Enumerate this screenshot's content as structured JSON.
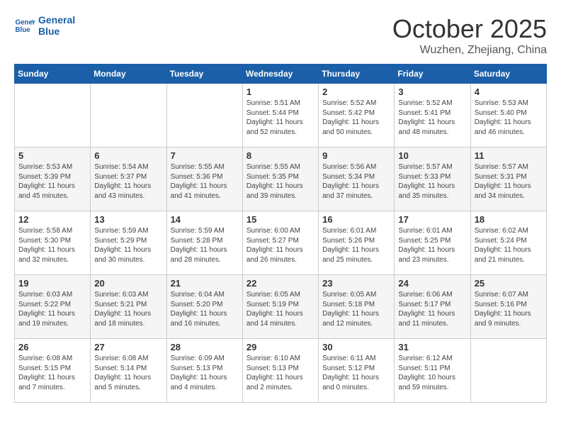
{
  "header": {
    "logo_general": "General",
    "logo_blue": "Blue",
    "title": "October 2025",
    "subtitle": "Wuzhen, Zhejiang, China"
  },
  "weekdays": [
    "Sunday",
    "Monday",
    "Tuesday",
    "Wednesday",
    "Thursday",
    "Friday",
    "Saturday"
  ],
  "weeks": [
    [
      {
        "day": "",
        "info": ""
      },
      {
        "day": "",
        "info": ""
      },
      {
        "day": "",
        "info": ""
      },
      {
        "day": "1",
        "info": "Sunrise: 5:51 AM\nSunset: 5:44 PM\nDaylight: 11 hours\nand 52 minutes."
      },
      {
        "day": "2",
        "info": "Sunrise: 5:52 AM\nSunset: 5:42 PM\nDaylight: 11 hours\nand 50 minutes."
      },
      {
        "day": "3",
        "info": "Sunrise: 5:52 AM\nSunset: 5:41 PM\nDaylight: 11 hours\nand 48 minutes."
      },
      {
        "day": "4",
        "info": "Sunrise: 5:53 AM\nSunset: 5:40 PM\nDaylight: 11 hours\nand 46 minutes."
      }
    ],
    [
      {
        "day": "5",
        "info": "Sunrise: 5:53 AM\nSunset: 5:39 PM\nDaylight: 11 hours\nand 45 minutes."
      },
      {
        "day": "6",
        "info": "Sunrise: 5:54 AM\nSunset: 5:37 PM\nDaylight: 11 hours\nand 43 minutes."
      },
      {
        "day": "7",
        "info": "Sunrise: 5:55 AM\nSunset: 5:36 PM\nDaylight: 11 hours\nand 41 minutes."
      },
      {
        "day": "8",
        "info": "Sunrise: 5:55 AM\nSunset: 5:35 PM\nDaylight: 11 hours\nand 39 minutes."
      },
      {
        "day": "9",
        "info": "Sunrise: 5:56 AM\nSunset: 5:34 PM\nDaylight: 11 hours\nand 37 minutes."
      },
      {
        "day": "10",
        "info": "Sunrise: 5:57 AM\nSunset: 5:33 PM\nDaylight: 11 hours\nand 35 minutes."
      },
      {
        "day": "11",
        "info": "Sunrise: 5:57 AM\nSunset: 5:31 PM\nDaylight: 11 hours\nand 34 minutes."
      }
    ],
    [
      {
        "day": "12",
        "info": "Sunrise: 5:58 AM\nSunset: 5:30 PM\nDaylight: 11 hours\nand 32 minutes."
      },
      {
        "day": "13",
        "info": "Sunrise: 5:59 AM\nSunset: 5:29 PM\nDaylight: 11 hours\nand 30 minutes."
      },
      {
        "day": "14",
        "info": "Sunrise: 5:59 AM\nSunset: 5:28 PM\nDaylight: 11 hours\nand 28 minutes."
      },
      {
        "day": "15",
        "info": "Sunrise: 6:00 AM\nSunset: 5:27 PM\nDaylight: 11 hours\nand 26 minutes."
      },
      {
        "day": "16",
        "info": "Sunrise: 6:01 AM\nSunset: 5:26 PM\nDaylight: 11 hours\nand 25 minutes."
      },
      {
        "day": "17",
        "info": "Sunrise: 6:01 AM\nSunset: 5:25 PM\nDaylight: 11 hours\nand 23 minutes."
      },
      {
        "day": "18",
        "info": "Sunrise: 6:02 AM\nSunset: 5:24 PM\nDaylight: 11 hours\nand 21 minutes."
      }
    ],
    [
      {
        "day": "19",
        "info": "Sunrise: 6:03 AM\nSunset: 5:22 PM\nDaylight: 11 hours\nand 19 minutes."
      },
      {
        "day": "20",
        "info": "Sunrise: 6:03 AM\nSunset: 5:21 PM\nDaylight: 11 hours\nand 18 minutes."
      },
      {
        "day": "21",
        "info": "Sunrise: 6:04 AM\nSunset: 5:20 PM\nDaylight: 11 hours\nand 16 minutes."
      },
      {
        "day": "22",
        "info": "Sunrise: 6:05 AM\nSunset: 5:19 PM\nDaylight: 11 hours\nand 14 minutes."
      },
      {
        "day": "23",
        "info": "Sunrise: 6:05 AM\nSunset: 5:18 PM\nDaylight: 11 hours\nand 12 minutes."
      },
      {
        "day": "24",
        "info": "Sunrise: 6:06 AM\nSunset: 5:17 PM\nDaylight: 11 hours\nand 11 minutes."
      },
      {
        "day": "25",
        "info": "Sunrise: 6:07 AM\nSunset: 5:16 PM\nDaylight: 11 hours\nand 9 minutes."
      }
    ],
    [
      {
        "day": "26",
        "info": "Sunrise: 6:08 AM\nSunset: 5:15 PM\nDaylight: 11 hours\nand 7 minutes."
      },
      {
        "day": "27",
        "info": "Sunrise: 6:08 AM\nSunset: 5:14 PM\nDaylight: 11 hours\nand 5 minutes."
      },
      {
        "day": "28",
        "info": "Sunrise: 6:09 AM\nSunset: 5:13 PM\nDaylight: 11 hours\nand 4 minutes."
      },
      {
        "day": "29",
        "info": "Sunrise: 6:10 AM\nSunset: 5:13 PM\nDaylight: 11 hours\nand 2 minutes."
      },
      {
        "day": "30",
        "info": "Sunrise: 6:11 AM\nSunset: 5:12 PM\nDaylight: 11 hours\nand 0 minutes."
      },
      {
        "day": "31",
        "info": "Sunrise: 6:12 AM\nSunset: 5:11 PM\nDaylight: 10 hours\nand 59 minutes."
      },
      {
        "day": "",
        "info": ""
      }
    ]
  ]
}
